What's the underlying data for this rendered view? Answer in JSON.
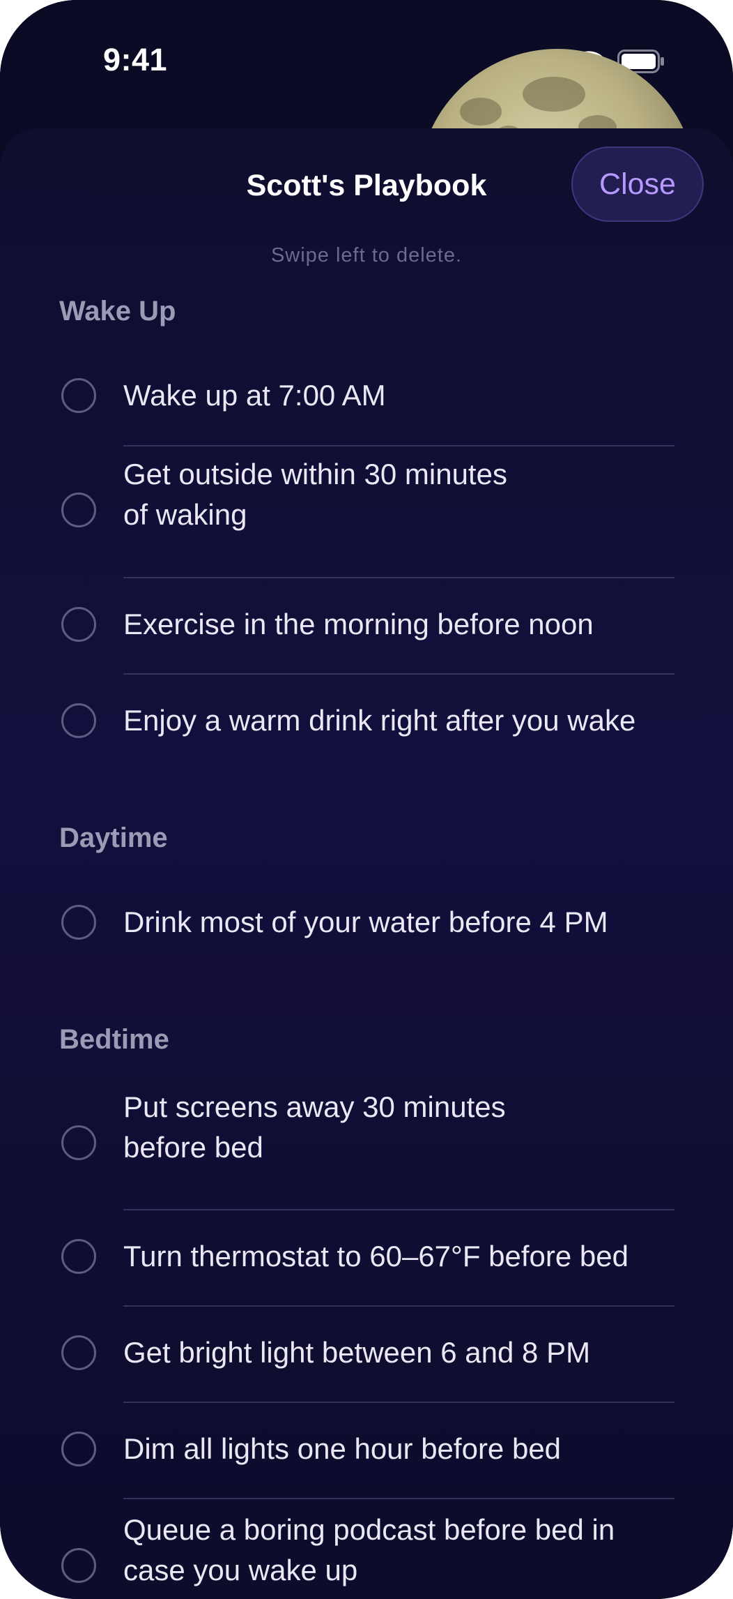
{
  "status_bar": {
    "time": "9:41",
    "icons": [
      "cellular-signal-icon",
      "wifi-icon",
      "battery-icon"
    ]
  },
  "sheet": {
    "title": "Scott's Playbook",
    "close_label": "Close",
    "hint": "Swipe left to delete."
  },
  "sections": [
    {
      "title": "Wake Up",
      "items": [
        "Wake up at 7:00 AM",
        "Get outside within 30 minutes\nof waking",
        "Exercise in the morning before noon",
        "Enjoy a warm drink right after you wake"
      ]
    },
    {
      "title": "Daytime",
      "items": [
        "Drink most of your water before 4 PM"
      ]
    },
    {
      "title": "Bedtime",
      "items": [
        "Put screens away 30 minutes\nbefore bed",
        "Turn thermostat to 60–67°F before bed",
        "Get bright light between 6 and 8 PM",
        "Dim all lights one hour before bed",
        "Queue a boring podcast before bed in\ncase you wake up"
      ]
    }
  ],
  "colors": {
    "accent": "#b899ff",
    "background": "#130f3d",
    "text": "#e9e8f4",
    "section_title": "#9c9ab4"
  }
}
